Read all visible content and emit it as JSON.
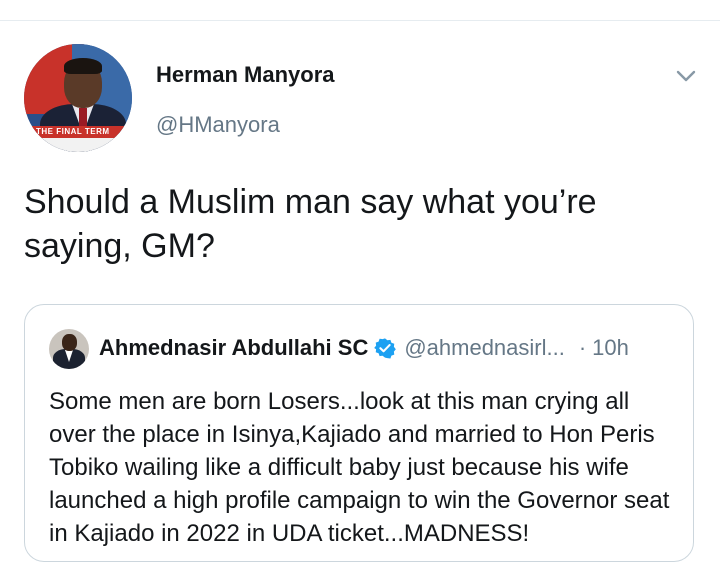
{
  "tweet": {
    "author_name": "Herman Manyora",
    "author_handle": "@HManyora",
    "text": "Should a Muslim man say what you’re saying, GM?",
    "avatar_caption": "THE FINAL TERM"
  },
  "quoted_tweet": {
    "author_name": "Ahmednasir Abdullahi SC",
    "author_handle": "@ahmednasirl...",
    "separator": "·",
    "time": "10h",
    "text": "Some men are born Losers...look at this man crying all over the place in Isinya,Kajiado and married to Hon Peris Tobiko wailing like a difficult baby just because his wife launched a high profile campaign to win the Governor seat in Kajiado in 2022 in UDA ticket...MADNESS!"
  },
  "icons": {
    "more": "chevron-down-icon",
    "verified": "verified-badge-icon"
  },
  "colors": {
    "text_primary": "#14171a",
    "text_secondary": "#657786",
    "verified_blue": "#1da1f2",
    "border": "#ccd6dd"
  }
}
